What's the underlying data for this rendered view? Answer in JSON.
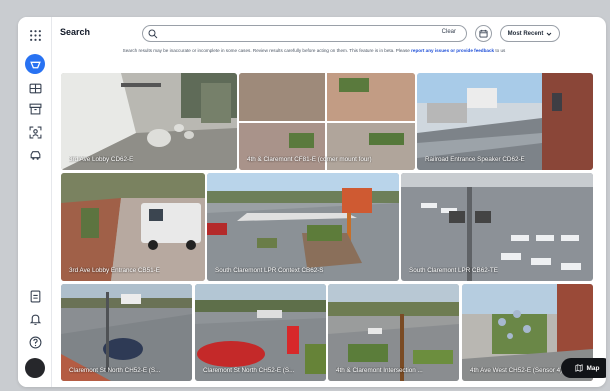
{
  "header": {
    "title": "Search",
    "search_placeholder": "",
    "clear_label": "Clear",
    "sort_label": "Most Recent",
    "disclaimer_text": "Search results may be inaccurate or incomplete in some cases. Review results carefully before acting on them. This feature is in beta. Please",
    "disclaimer_link": "report any issues or provide feedback",
    "disclaimer_tail": "to us"
  },
  "sidebar": {
    "items": [
      "grid-menu-icon",
      "search-icon",
      "video-grid-icon",
      "archive-icon",
      "person-scan-icon",
      "vehicle-icon",
      "report-icon",
      "bell-icon",
      "help-icon",
      "avatar"
    ]
  },
  "results": [
    {
      "label": "3rd Ave Lobby CD62-E"
    },
    {
      "label": "4th & Claremont CF81-E (corner mount four)"
    },
    {
      "label": "Railroad Entrance Speaker CD62-E"
    },
    {
      "label": "3rd Ave Lobby Entrance CB51-E"
    },
    {
      "label": "South Claremont LPR Context CB62-S"
    },
    {
      "label": "South Claremont LPR CB62-TE"
    },
    {
      "label": "Claremont St North CH52-E (S..."
    },
    {
      "label": "Claremont St North CH52-E (S..."
    },
    {
      "label": "4th & Claremont Intersection ..."
    },
    {
      "label": "4th Ave West CH52-E (Sensor 4)"
    }
  ],
  "map_button": {
    "label": "Map"
  },
  "colors": {
    "accent": "#2872f2",
    "link": "#1d4ed8"
  }
}
